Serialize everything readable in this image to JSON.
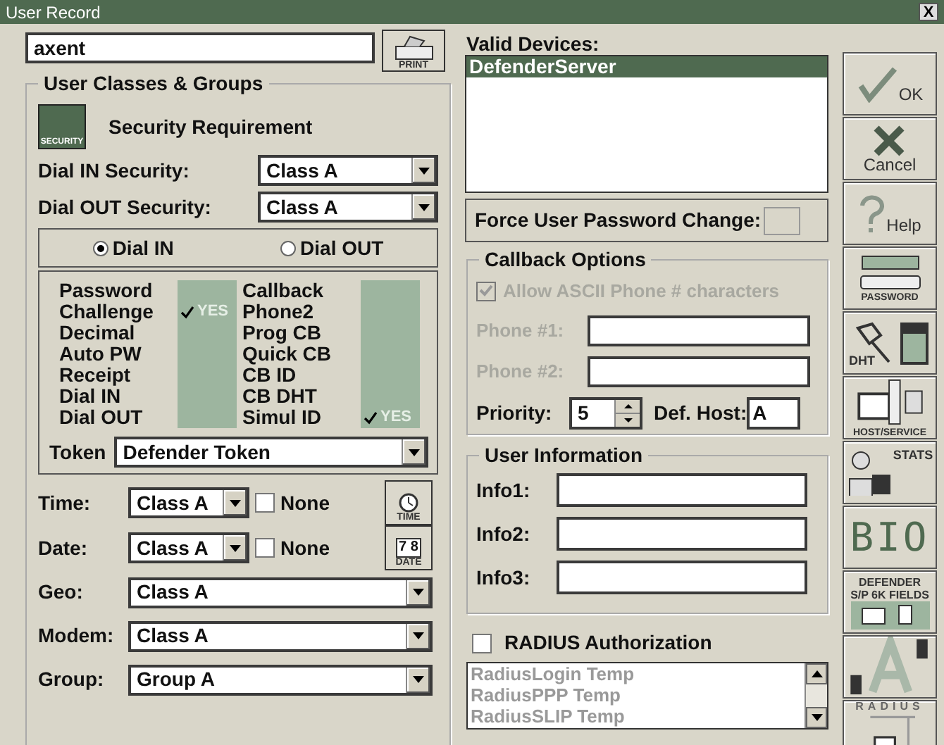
{
  "window": {
    "title": "User Record",
    "close": "X"
  },
  "user_name": {
    "value": "axent"
  },
  "print_button": {
    "label": "PRINT"
  },
  "classes": {
    "title": "User Classes & Groups",
    "security_icon_label": "SECURITY",
    "security_title": "Security Requirement",
    "dial_in_security": {
      "label": "Dial IN Security:",
      "value": "Class A"
    },
    "dial_out_security": {
      "label": "Dial OUT Security:",
      "value": "Class A"
    },
    "direction": [
      {
        "label": "Dial IN",
        "selected": true
      },
      {
        "label": "Dial OUT",
        "selected": false
      }
    ],
    "flags_left": [
      {
        "label": "Password",
        "checked": false
      },
      {
        "label": "Challenge",
        "checked": true,
        "badge": "YES"
      },
      {
        "label": "Decimal",
        "checked": false
      },
      {
        "label": "Auto PW",
        "checked": false
      },
      {
        "label": "Receipt",
        "checked": false
      },
      {
        "label": "Dial IN",
        "checked": false
      },
      {
        "label": "Dial OUT",
        "checked": false
      }
    ],
    "flags_right": [
      {
        "label": "Callback",
        "checked": false
      },
      {
        "label": "Phone2",
        "checked": false
      },
      {
        "label": "Prog CB",
        "checked": false
      },
      {
        "label": "Quick CB",
        "checked": false
      },
      {
        "label": "CB ID",
        "checked": false
      },
      {
        "label": "CB DHT",
        "checked": false
      },
      {
        "label": "Simul ID",
        "checked": true,
        "badge": "YES"
      }
    ],
    "token": {
      "label": "Token",
      "value": "Defender Token"
    },
    "time": {
      "label": "Time:",
      "value": "Class A",
      "none_label": "None",
      "none_checked": false,
      "button": "TIME"
    },
    "date": {
      "label": "Date:",
      "value": "Class A",
      "none_label": "None",
      "none_checked": false,
      "button": "DATE",
      "icon_text": "7 8"
    },
    "selects": [
      {
        "label": "Geo:",
        "value": "Class A"
      },
      {
        "label": "Modem:",
        "value": "Class A"
      },
      {
        "label": "Group:",
        "value": "Group A"
      }
    ]
  },
  "valid_devices": {
    "label": "Valid Devices:",
    "items": [
      {
        "label": "DefenderServer",
        "selected": true
      }
    ]
  },
  "force_password_change": {
    "label": "Force User Password Change:",
    "checked": false
  },
  "callback_options": {
    "title": "Callback Options",
    "disabled": true,
    "allow_ascii": {
      "label": "Allow ASCII Phone # characters",
      "checked": true
    },
    "phone1": {
      "label": "Phone #1:"
    },
    "phone2": {
      "label": "Phone #2:"
    },
    "priority": {
      "label": "Priority:",
      "value": "5"
    },
    "def_host": {
      "label": "Def. Host:",
      "value": "A"
    }
  },
  "user_information": {
    "title": "User Information",
    "fields": [
      {
        "label": "Info1:"
      },
      {
        "label": "Info2:"
      },
      {
        "label": "Info3:"
      }
    ]
  },
  "radius": {
    "label": "RADIUS Authorization",
    "checked": false,
    "items": [
      "RadiusLogin Temp",
      "RadiusPPP Temp",
      "RadiusSLIP Temp"
    ]
  },
  "toolbar": [
    {
      "kind": "ok",
      "label": "OK"
    },
    {
      "kind": "cancel",
      "label": "Cancel"
    },
    {
      "kind": "help",
      "label": "Help"
    },
    {
      "kind": "password",
      "label": "PASSWORD"
    },
    {
      "kind": "dht",
      "label": "DHT"
    },
    {
      "kind": "host",
      "label": "HOST/SERVICE"
    },
    {
      "kind": "stats",
      "label": "STATS"
    },
    {
      "kind": "bio",
      "label": "BIO"
    },
    {
      "kind": "fields",
      "label": "DEFENDER S/P 6K FIELDS"
    },
    {
      "kind": "axent"
    },
    {
      "kind": "radius",
      "label": "RADIUS"
    }
  ]
}
